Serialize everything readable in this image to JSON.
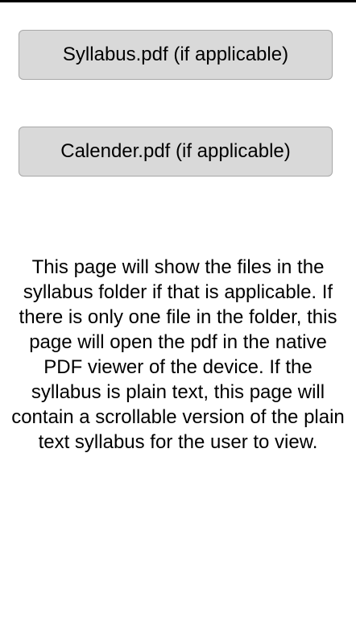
{
  "buttons": {
    "syllabus_label": "Syllabus.pdf (if applicable)",
    "calendar_label": "Calender.pdf (if applicable)"
  },
  "description": "This page will show the files in the syllabus folder if that is applicable. If there is only one file in the folder, this page will open the pdf in the native PDF viewer of the device. If the syllabus is plain text, this page will contain a scrollable version of the plain text syllabus for the user to view.",
  "colors": {
    "button_background": "#d9d9d9",
    "button_border": "#a8a8a8",
    "text": "#000000",
    "background": "#ffffff"
  }
}
